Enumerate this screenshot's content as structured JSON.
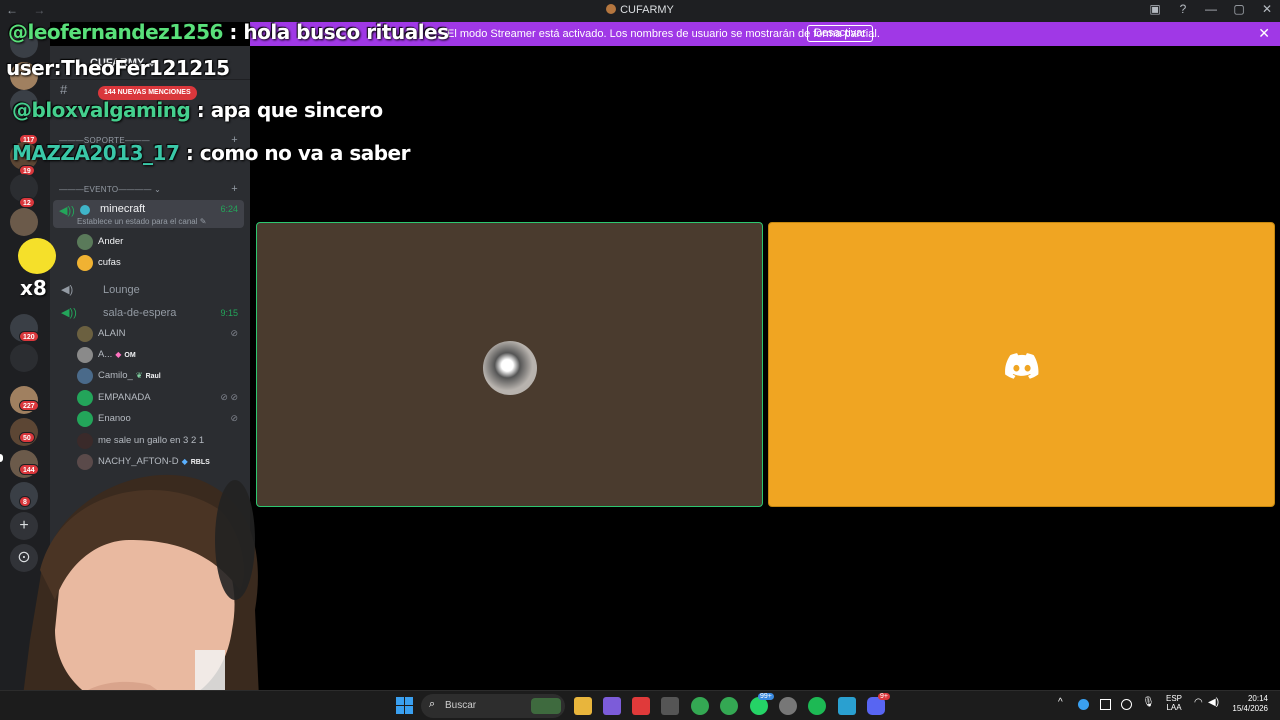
{
  "window": {
    "title": "CUFARMY",
    "nav_back": "←",
    "nav_forward": "→",
    "controls": [
      "▣",
      "?",
      "—",
      "▢",
      "✕"
    ]
  },
  "streamer_notice": {
    "text": "El modo Streamer está activado. Los nombres de usuario se mostrarán de forma parcial.",
    "button": "Desactivar",
    "close": "✕"
  },
  "rail": {
    "badges": [
      "117",
      "19",
      "12",
      "120",
      "227",
      "50",
      "144",
      "8"
    ],
    "add_glyph": "+",
    "explore_glyph": "⊙"
  },
  "sidebar": {
    "server_name": "CUFARMY ⌄",
    "mentions_badge": "144 NUEVAS MENCIONES",
    "categories": {
      "soporte": "———SOPORTE———",
      "evento": "———EVENTO———— ⌄"
    },
    "active_channel": {
      "name": "minecraft",
      "time": "6:24",
      "status": "Establece un estado para el canal ✎"
    },
    "minecraft_users": [
      {
        "name": "Ander"
      },
      {
        "name": "cufas"
      }
    ],
    "channels": [
      {
        "name": "Lounge"
      },
      {
        "name": "sala-de-espera",
        "time": "9:15"
      }
    ],
    "wait_users": [
      {
        "name": "ALAIN",
        "tag": "",
        "mute": "⊘"
      },
      {
        "name": "A...",
        "tag": "OM",
        "mute": ""
      },
      {
        "name": "Camilo_",
        "tag": "Raul",
        "mute": ""
      },
      {
        "name": "EMPANADA",
        "tag": "",
        "mute": "⊘ ⊘"
      },
      {
        "name": "Enanoo",
        "tag": "",
        "mute": "⊘"
      },
      {
        "name": "me sale un gallo en 3 2 1",
        "tag": "",
        "mute": ""
      },
      {
        "name": "NACHY_AFTON-D",
        "tag": "RBLS",
        "mute": ""
      }
    ]
  },
  "overlay_chat": {
    "user_line": "user:TheoFer121215",
    "messages": [
      {
        "user": "@leofernandez1256",
        "text": " : hola busco rituales"
      },
      {
        "user": "@bloxvalgaming",
        "text": " : apa que sincero"
      },
      {
        "user": "MAZZA2013_17",
        "text": " : como no va a saber"
      }
    ],
    "sticker_text": "x8"
  },
  "taskbar": {
    "search_placeholder": "Buscar",
    "lang_top": "ESP",
    "lang_bottom": "LAA",
    "time": "20:14",
    "date": "15/4/2026",
    "discord_badge": "9+",
    "whatsapp_badge": "99+"
  },
  "colors": {
    "notice_bg": "#a038e6",
    "speaking_border": "#2dc770",
    "discord_tile": "#f0a522",
    "badge_red": "#da373c"
  }
}
